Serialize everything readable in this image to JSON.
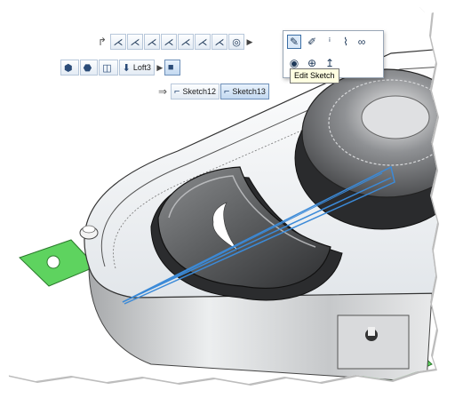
{
  "toolbar": {
    "row1": {
      "icons": [
        "fillet-icon",
        "fillet-icon",
        "fillet-icon",
        "fillet-icon",
        "fillet-icon",
        "fillet-icon",
        "fillet-icon",
        "circle-target-icon"
      ]
    },
    "row2": {
      "breadcrumb_label": "Loft3"
    },
    "row3": {
      "sketch12_label": "Sketch12",
      "sketch13_label": "Sketch13"
    },
    "context_panel": {
      "tooltip": "Edit Sketch",
      "icons": [
        "edit-sketch-icon",
        "smart-dimension-icon",
        "info-icon",
        "paperclip-icon",
        "link-icon",
        "eye-icon",
        "zoom-icon",
        "normal-to-icon"
      ]
    }
  },
  "colors": {
    "accent_blue": "#3b8ad8",
    "pcb_green": "#58d05a",
    "toolbar_border": "#b7c7da",
    "tooltip_bg": "#ffffe1"
  }
}
